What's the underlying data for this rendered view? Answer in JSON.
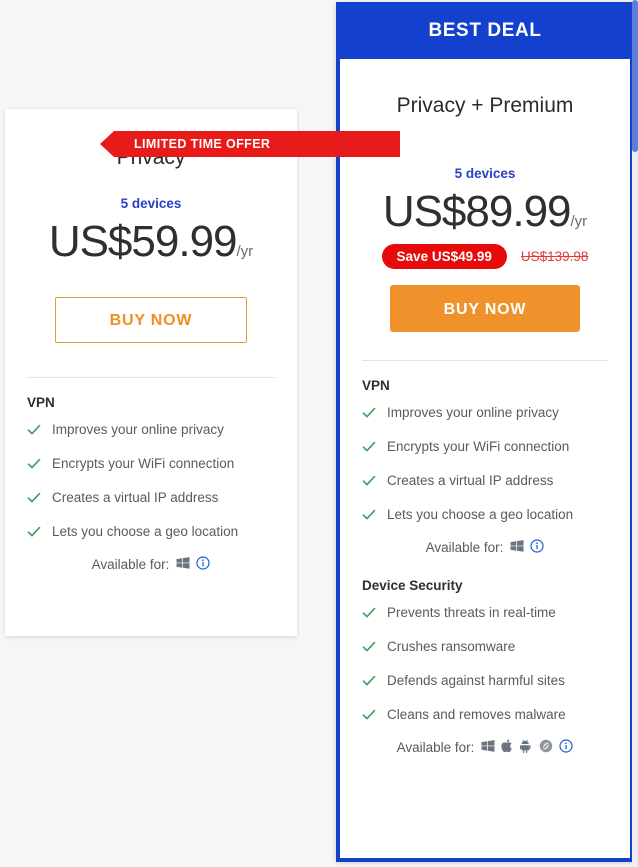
{
  "colors": {
    "brand_blue": "#1340cc",
    "accent_orange": "#f0922b",
    "sale_red": "#e60a0a",
    "check_green": "#3fa35c",
    "devices_blue": "#2b3fc4",
    "page_background": "#f5f6f8"
  },
  "plans": {
    "basic": {
      "title": "Privacy",
      "devices": "5 devices",
      "price": "US$59.99",
      "period": "/yr",
      "buy_label": "BUY NOW",
      "sections": [
        {
          "heading": "VPN",
          "features": [
            "Improves your online privacy",
            "Encrypts your WiFi connection",
            "Creates a virtual IP address",
            "Lets you choose a geo location"
          ],
          "available_label": "Available for:",
          "platforms": [
            "windows-icon",
            "info-icon"
          ]
        }
      ]
    },
    "featured": {
      "banner": "BEST DEAL",
      "title": "Privacy + Premium",
      "ribbon": "LIMITED TIME OFFER",
      "devices": "5 devices",
      "price": "US$89.99",
      "period": "/yr",
      "save_badge": "Save US$49.99",
      "old_price": "US$139.98",
      "buy_label": "BUY NOW",
      "sections": [
        {
          "heading": "VPN",
          "features": [
            "Improves your online privacy",
            "Encrypts your WiFi connection",
            "Creates a virtual IP address",
            "Lets you choose a geo location"
          ],
          "available_label": "Available for:",
          "platforms": [
            "windows-icon",
            "info-icon"
          ]
        },
        {
          "heading": "Device Security",
          "features": [
            "Prevents threats in real-time",
            "Crushes ransomware",
            "Defends against harmful sites",
            "Cleans and removes malware"
          ],
          "available_label": "Available for:",
          "platforms": [
            "windows-icon",
            "apple-icon",
            "android-icon",
            "mac-swirl-icon",
            "info-icon"
          ]
        }
      ]
    }
  }
}
